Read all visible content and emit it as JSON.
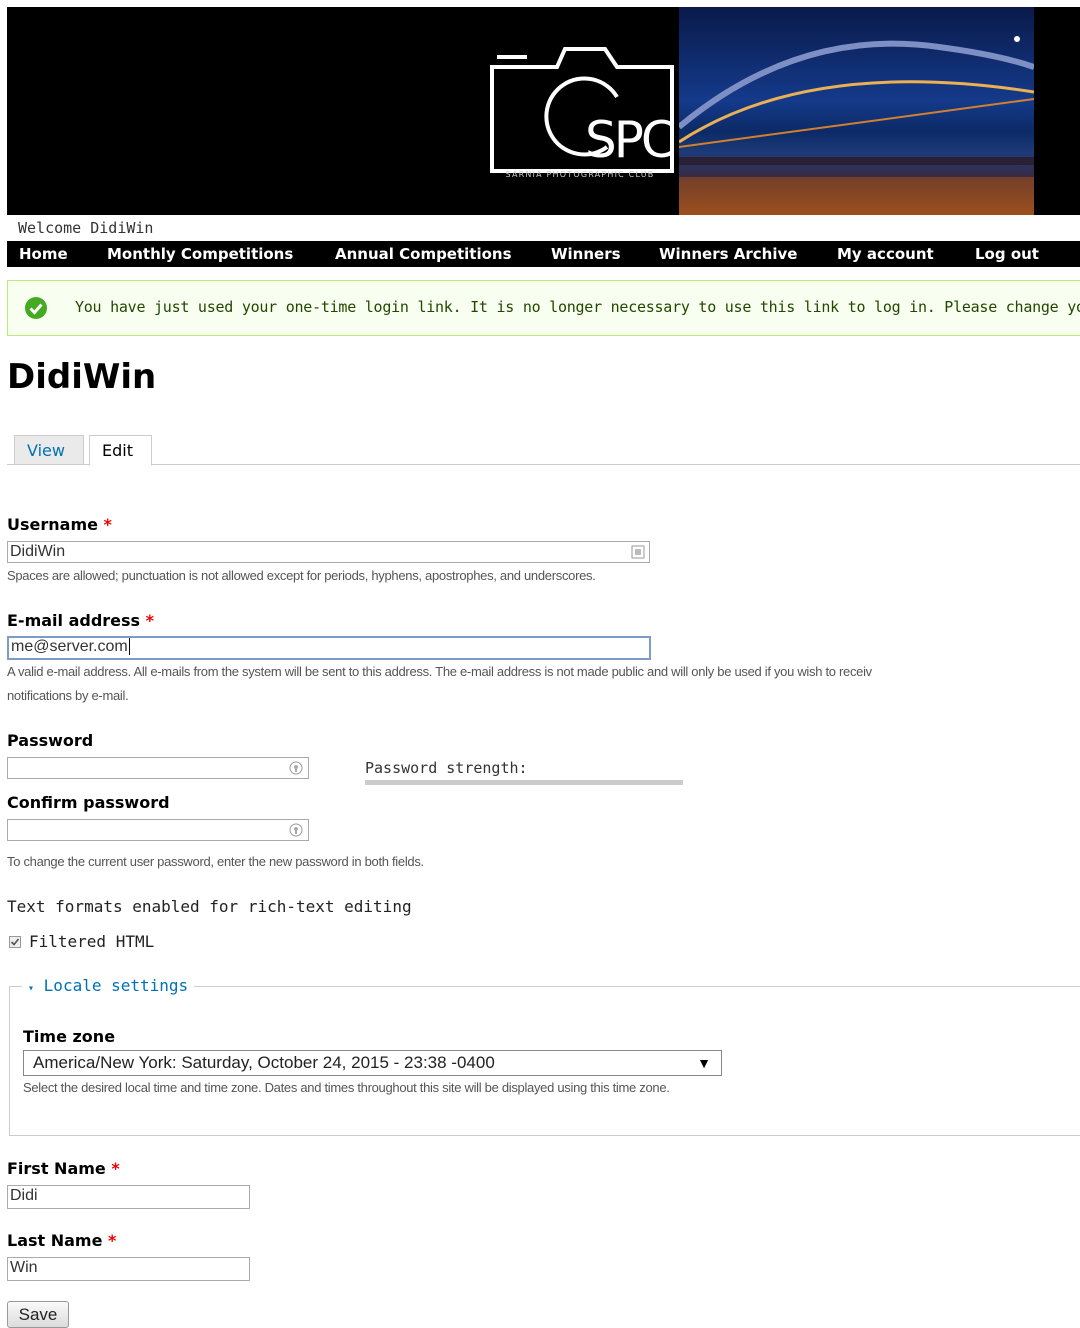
{
  "banner": {
    "logo_text": "SPC",
    "logo_subtitle": "SARNIA PHOTOGRAPHIC CLUB"
  },
  "welcome": "Welcome DidiWin",
  "nav": {
    "home": "Home",
    "monthly": "Monthly Competitions",
    "annual": "Annual Competitions",
    "winners": "Winners",
    "archive": "Winners Archive",
    "account": "My account",
    "logout": "Log out"
  },
  "message": {
    "text": "You have just used your one-time login link. It is no longer necessary to use this link to log in. Please change your pa",
    "icon": "check-circle-icon",
    "color": "#44aa22"
  },
  "page_title": "DidiWin",
  "tabs": {
    "view": "View",
    "edit": "Edit"
  },
  "form": {
    "required_mark": "*",
    "username": {
      "label": "Username",
      "value": "DidiWin",
      "description": "Spaces are allowed; punctuation is not allowed except for periods, hyphens, apostrophes, and underscores."
    },
    "email": {
      "label": "E-mail address",
      "value": "me@server.com",
      "description_1": "A valid e-mail address. All e-mails from the system will be sent to this address. The e-mail address is not made public and will only be used if you wish to receiv",
      "description_2": "notifications by e-mail."
    },
    "password": {
      "label": "Password",
      "value": ""
    },
    "password_strength": "Password strength:",
    "confirm_password": {
      "label": "Confirm password",
      "value": ""
    },
    "password_description": "To change the current user password, enter the new password in both fields.",
    "text_formats": {
      "label": "Text formats enabled for rich-text editing",
      "option": "Filtered HTML",
      "checked": true
    },
    "locale": {
      "legend": "Locale settings",
      "timezone_label": "Time zone",
      "timezone_value": "America/New York: Saturday, October 24, 2015 - 23:38 -0400",
      "timezone_description": "Select the desired local time and time zone. Dates and times throughout this site will be displayed using this time zone."
    },
    "first_name": {
      "label": "First Name",
      "value": "Didi"
    },
    "last_name": {
      "label": "Last Name",
      "value": "Win"
    },
    "save": "Save"
  }
}
